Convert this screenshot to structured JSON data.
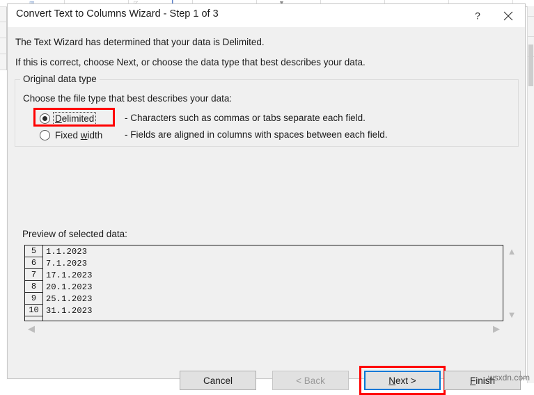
{
  "dialog": {
    "title": "Convert Text to Columns Wizard - Step 1 of 3",
    "help_icon": "question-mark-icon",
    "close_icon": "close-icon",
    "intro_line_1": "The Text Wizard has determined that your data is Delimited.",
    "intro_line_2": "If this is correct, choose Next, or choose the data type that best describes your data."
  },
  "group": {
    "legend": "Original data type",
    "choose_label": "Choose the file type that best describes your data:",
    "options": [
      {
        "label": "Delimited",
        "accel": "D",
        "label_prefix": "",
        "label_suffix": "elimited",
        "description": "- Characters such as commas or tabs separate each field.",
        "selected": true,
        "focused": true,
        "annotated": true
      },
      {
        "label": "Fixed width",
        "accel": "w",
        "label_prefix": "Fixed ",
        "label_suffix": "idth",
        "description": "- Fields are aligned in columns with spaces between each field.",
        "selected": false,
        "focused": false,
        "annotated": false
      }
    ]
  },
  "preview": {
    "label": "Preview of selected data:",
    "rows": [
      {
        "num": "5",
        "value": "1.1.2023"
      },
      {
        "num": "6",
        "value": "7.1.2023"
      },
      {
        "num": "7",
        "value": "17.1.2023"
      },
      {
        "num": "8",
        "value": "20.1.2023"
      },
      {
        "num": "9",
        "value": "25.1.2023"
      },
      {
        "num": "10",
        "value": "31.1.2023"
      }
    ],
    "scroll_up_icon": "chevron-up-icon",
    "scroll_down_icon": "chevron-down-icon",
    "scroll_left_icon": "chevron-left-icon",
    "scroll_right_icon": "chevron-right-icon"
  },
  "buttons": {
    "cancel": "Cancel",
    "back": "< Back",
    "next_prefix": "",
    "next_accel": "N",
    "next_suffix": "ext >",
    "finish_prefix": "",
    "finish_accel": "F",
    "finish_suffix": "inish"
  },
  "annotations": {
    "color": "#ff0000",
    "default_button_color": "#0078d7"
  },
  "watermark": "wsxdn.com"
}
